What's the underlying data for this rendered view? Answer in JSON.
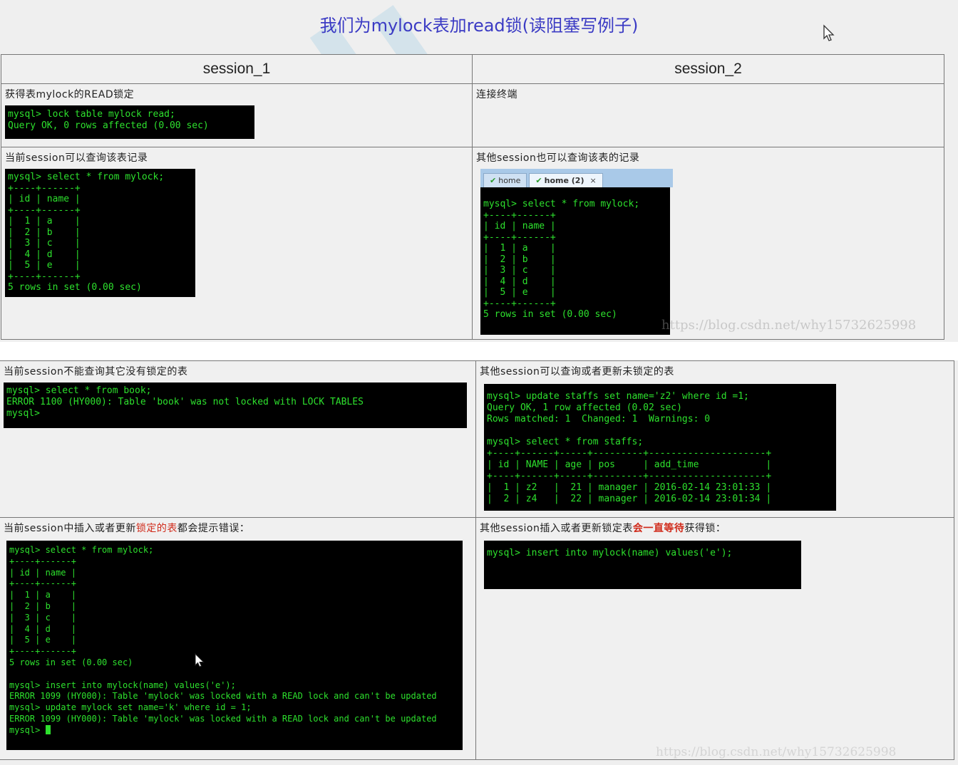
{
  "title": "我们为mylock表加read锁(读阻塞写例子)",
  "headers": {
    "s1": "session_1",
    "s2": "session_2"
  },
  "row1": {
    "s1_caption": "获得表mylock的READ锁定",
    "s1_term": "mysql> lock table mylock read;\nQuery OK, 0 rows affected (0.00 sec)",
    "s2_caption": "连接终端"
  },
  "row2": {
    "s1_caption": "当前session可以查询该表记录",
    "s1_term": "mysql> select * from mylock;\n+----+------+\n| id | name |\n+----+------+\n|  1 | a    |\n|  2 | b    |\n|  3 | c    |\n|  4 | d    |\n|  5 | e    |\n+----+------+\n5 rows in set (0.00 sec)",
    "s2_caption": "其他session也可以查询该表的记录",
    "s2_tab1": "home",
    "s2_tab2": "home (2)",
    "s2_term": "mysql> select * from mylock;\n+----+------+\n| id | name |\n+----+------+\n|  1 | a    |\n|  2 | b    |\n|  3 | c    |\n|  4 | d    |\n|  5 | e    |\n+----+------+\n5 rows in set (0.00 sec)"
  },
  "row3": {
    "s1_caption": "当前session不能查询其它没有锁定的表",
    "s1_term": "mysql> select * from book;\nERROR 1100 (HY000): Table 'book' was not locked with LOCK TABLES\nmysql>",
    "s2_caption": "其他session可以查询或者更新未锁定的表",
    "s2_term": "mysql> update staffs set name='z2' where id =1;\nQuery OK, 1 row affected (0.02 sec)\nRows matched: 1  Changed: 1  Warnings: 0\n\nmysql> select * from staffs;\n+----+------+-----+---------+---------------------+\n| id | NAME | age | pos     | add_time            |\n+----+------+-----+---------+---------------------+\n|  1 | z2   |  21 | manager | 2016-02-14 23:01:33 |\n|  2 | z4   |  22 | manager | 2016-02-14 23:01:34 |"
  },
  "row4": {
    "s1_caption_a": "当前session中插入或者更新",
    "s1_caption_red": "锁定的表",
    "s1_caption_b": "都会提示错误：",
    "s1_term": "mysql> select * from mylock;\n+----+------+\n| id | name |\n+----+------+\n|  1 | a    |\n|  2 | b    |\n|  3 | c    |\n|  4 | d    |\n|  5 | e    |\n+----+------+\n5 rows in set (0.00 sec)\n\nmysql> insert into mylock(name) values('e');\nERROR 1099 (HY000): Table 'mylock' was locked with a READ lock and can't be updated\nmysql> update mylock set name='k' where id = 1;\nERROR 1099 (HY000): Table 'mylock' was locked with a READ lock and can't be updated\nmysql> ",
    "s2_caption_a": "其他session插入或者更新锁定表",
    "s2_caption_red": "会一直等待",
    "s2_caption_b": "获得锁：",
    "s2_term": "mysql> insert into mylock(name) values('e');"
  },
  "watermarks": {
    "w1": "https://blog.csdn.net/why15732625998",
    "w2": "https://blog.csdn.net/why15732625998"
  },
  "colors": {
    "terminal_bg": "#000000",
    "terminal_fg": "#2de02d",
    "title": "#3b3bc4",
    "highlight": "#d02a1a"
  }
}
